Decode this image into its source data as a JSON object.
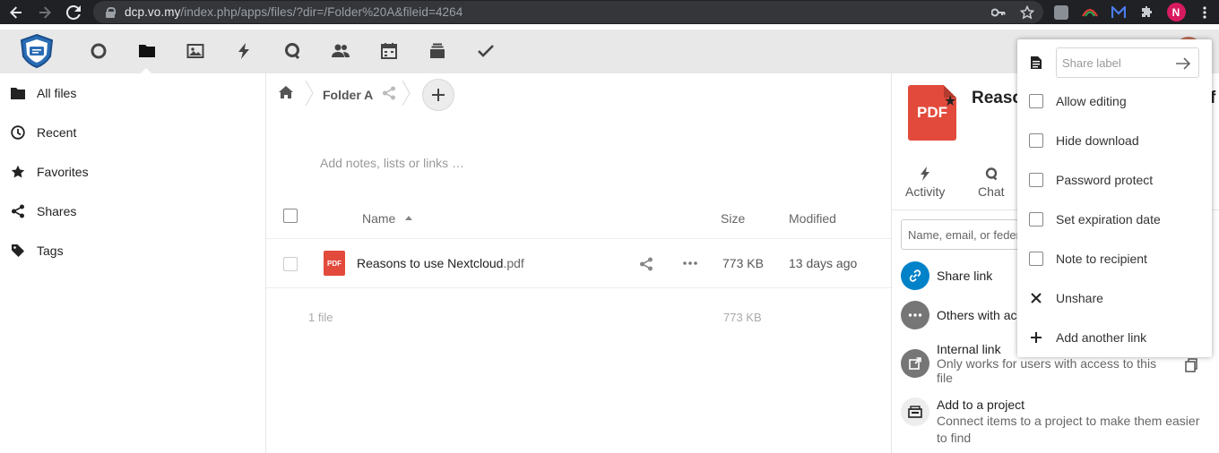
{
  "browser": {
    "url_host": "dcp.vo.my",
    "url_path": "/index.php/apps/files/?dir=/Folder%20A&fileid=4264",
    "profile_initial": "N",
    "icons": [
      "back-icon",
      "forward-icon",
      "reload-icon",
      "lock-icon",
      "key-icon",
      "star-icon",
      "extensions-icon",
      "menu-icon"
    ]
  },
  "header": {
    "apps": [
      "dashboard",
      "files",
      "photos",
      "activity",
      "talk",
      "contacts",
      "calendar",
      "deck",
      "tasks"
    ]
  },
  "leftnav": {
    "items": [
      {
        "label": "All files"
      },
      {
        "label": "Recent"
      },
      {
        "label": "Favorites"
      },
      {
        "label": "Shares"
      },
      {
        "label": "Tags"
      }
    ]
  },
  "main": {
    "breadcrumb_folder": "Folder A",
    "notes_placeholder": "Add notes, lists or links …",
    "columns": {
      "name": "Name",
      "size": "Size",
      "modified": "Modified"
    },
    "file": {
      "thumb_label": "PDF",
      "name": "Reasons to use Nextcloud",
      "ext": ".pdf",
      "size": "773 KB",
      "modified": "13 days ago"
    },
    "summary": {
      "count": "1 file",
      "size": "773 KB"
    }
  },
  "sidebar": {
    "thumb_label": "PDF",
    "title": "Reasons to use Nextcloud.pdf",
    "tabs": [
      {
        "label": "Activity"
      },
      {
        "label": "Chat"
      }
    ],
    "share_input_placeholder": "Name, email, or federated cloud ID …",
    "share_link_label": "Share link",
    "others_label": "Others with access",
    "internal_link_title": "Internal link",
    "internal_link_sub": "Only works for users with access to this file",
    "project_title": "Add to a project",
    "project_sub": "Connect items to a project to make them easier to find",
    "colors": {
      "link": "#0082c9",
      "grey": "#767676"
    }
  },
  "popover": {
    "share_label_placeholder": "Share label",
    "items": [
      {
        "label": "Allow editing"
      },
      {
        "label": "Hide download"
      },
      {
        "label": "Password protect"
      },
      {
        "label": "Set expiration date"
      },
      {
        "label": "Note to recipient"
      },
      {
        "label": "Unshare"
      },
      {
        "label": "Add another link"
      }
    ]
  }
}
